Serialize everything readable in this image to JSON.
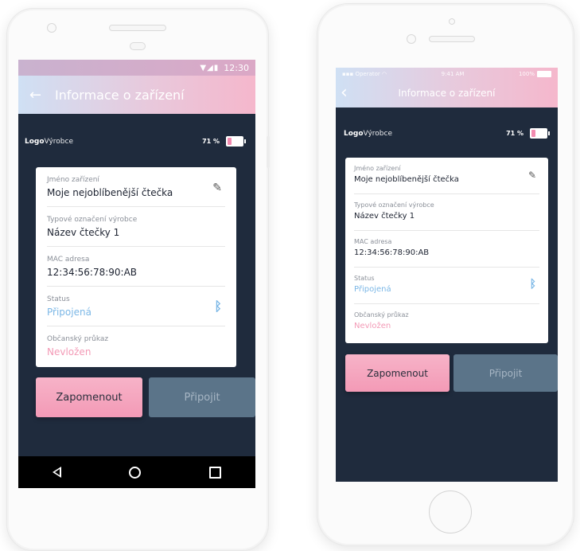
{
  "screen": {
    "title": "Informace o zařízení",
    "brand": {
      "bold": "Logo",
      "light": "Výrobce"
    },
    "battery": {
      "text": "71 %",
      "level": 0.25
    },
    "fields": [
      {
        "label": "Jméno zařízení",
        "value": "Moje nejoblíbenější čtečka",
        "action_icon": "pencil-icon"
      },
      {
        "label": "Typové označení výrobce",
        "value": "Název čtečky 1"
      },
      {
        "label": "MAC adresa",
        "value": "12:34:56:78:90:AB"
      },
      {
        "label": "Status",
        "value": "Připojená",
        "status_icon": "bluetooth-icon"
      },
      {
        "label": "Občanský průkaz",
        "value": "Nevložen"
      }
    ],
    "buttons": {
      "forget": "Zapomenout",
      "connect": "Připojit"
    }
  },
  "android": {
    "status_time": "12:30"
  },
  "ios": {
    "status_carrier": "Operator",
    "status_time": "9:41 AM",
    "status_battery": "100%"
  },
  "colors": {
    "screen_bg": "#1f2b3d",
    "header_gradient_start": "#cfe0f4",
    "header_gradient_end": "#f5b7cc",
    "primary_button": "#f39ab6",
    "secondary_button": "#5b7489",
    "connected": "#7bb7e6",
    "missing": "#f39ab6"
  }
}
